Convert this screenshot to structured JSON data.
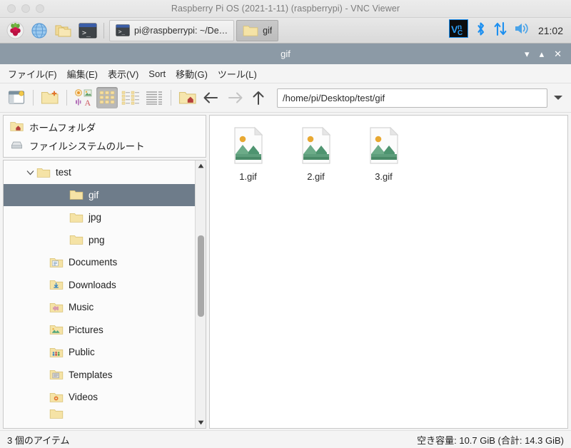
{
  "vnc": {
    "title": "Raspberry Pi OS (2021-1-11) (raspberrypi) - VNC Viewer",
    "traffic_lights": [
      "close",
      "minimize",
      "maximize"
    ]
  },
  "taskbar": {
    "launchers": [
      {
        "name": "raspberry-menu-icon",
        "label": "Raspberry Pi Menu"
      },
      {
        "name": "browser-icon",
        "label": "Web Browser"
      },
      {
        "name": "file-manager-icon",
        "label": "File Manager"
      },
      {
        "name": "terminal-icon",
        "label": "Terminal"
      }
    ],
    "windows": [
      {
        "label": "pi@raspberrypi: ~/De…",
        "icon": "terminal-icon",
        "active": false
      },
      {
        "label": "gif",
        "icon": "folder-icon",
        "active": true
      }
    ],
    "tray": [
      {
        "name": "vnc-icon",
        "label": "VNC"
      },
      {
        "name": "bluetooth-icon",
        "label": "Bluetooth"
      },
      {
        "name": "network-icon",
        "label": "Network"
      },
      {
        "name": "volume-icon",
        "label": "Volume"
      }
    ],
    "clock": "21:02"
  },
  "filemanager": {
    "title": "gif",
    "window_controls": {
      "minimize": "▾",
      "maximize": "▴",
      "close": "✕"
    },
    "menu": [
      {
        "label": "ファイル(F)",
        "name": "menu-file"
      },
      {
        "label": "編集(E)",
        "name": "menu-edit"
      },
      {
        "label": "表示(V)",
        "name": "menu-view"
      },
      {
        "label": "Sort",
        "name": "menu-sort"
      },
      {
        "label": "移動(G)",
        "name": "menu-go"
      },
      {
        "label": "ツール(L)",
        "name": "menu-tools"
      }
    ],
    "toolbar": {
      "new_tab": "new-tab-button",
      "new_folder": "new-folder-button",
      "file_types": "file-types-button",
      "icon_view": "icon-view-button",
      "compact_view": "compact-view-button",
      "detailed_view": "detailed-list-view-button",
      "home": "home-button",
      "back": "back-button",
      "forward": "forward-button",
      "up": "up-button",
      "active_view": "icon_view"
    },
    "path": {
      "value": "/home/pi/Desktop/test/gif",
      "placeholder": "/home/pi/Desktop/test/gif"
    },
    "places": [
      {
        "label": "ホームフォルダ",
        "icon": "home-folder-icon"
      },
      {
        "label": "ファイルシステムのルート",
        "icon": "drive-icon"
      }
    ],
    "tree": [
      {
        "label": "test",
        "icon": "folder-icon",
        "indent": 1,
        "expander": "▾",
        "selected": false
      },
      {
        "label": "gif",
        "icon": "folder-icon",
        "indent": 2,
        "expander": "",
        "selected": true
      },
      {
        "label": "jpg",
        "icon": "folder-icon",
        "indent": 2,
        "expander": "",
        "selected": false
      },
      {
        "label": "png",
        "icon": "folder-icon",
        "indent": 2,
        "expander": "",
        "selected": false
      },
      {
        "label": "Documents",
        "icon": "documents-icon",
        "indent": 1,
        "expander": "",
        "selected": false
      },
      {
        "label": "Downloads",
        "icon": "downloads-icon",
        "indent": 1,
        "expander": "",
        "selected": false
      },
      {
        "label": "Music",
        "icon": "music-icon",
        "indent": 1,
        "expander": "",
        "selected": false
      },
      {
        "label": "Pictures",
        "icon": "pictures-icon",
        "indent": 1,
        "expander": "",
        "selected": false
      },
      {
        "label": "Public",
        "icon": "public-icon",
        "indent": 1,
        "expander": "",
        "selected": false
      },
      {
        "label": "Templates",
        "icon": "templates-icon",
        "indent": 1,
        "expander": "",
        "selected": false
      },
      {
        "label": "Videos",
        "icon": "videos-icon",
        "indent": 1,
        "expander": "",
        "selected": false
      }
    ],
    "files": [
      {
        "label": "1.gif",
        "icon": "image-file-icon"
      },
      {
        "label": "2.gif",
        "icon": "image-file-icon"
      },
      {
        "label": "3.gif",
        "icon": "image-file-icon"
      }
    ],
    "status": {
      "items": "3 個のアイテム",
      "free_space": "空き容量: 10.7 GiB (合計: 14.3 GiB)"
    }
  },
  "colors": {
    "fm_titlebar": "#8c9aa6",
    "tree_selection": "#6e7c8a",
    "taskbar_bg": "#e1e1e1",
    "folder_yellow": "#f4dfa0",
    "accent_blue": "#1c8ff0"
  }
}
